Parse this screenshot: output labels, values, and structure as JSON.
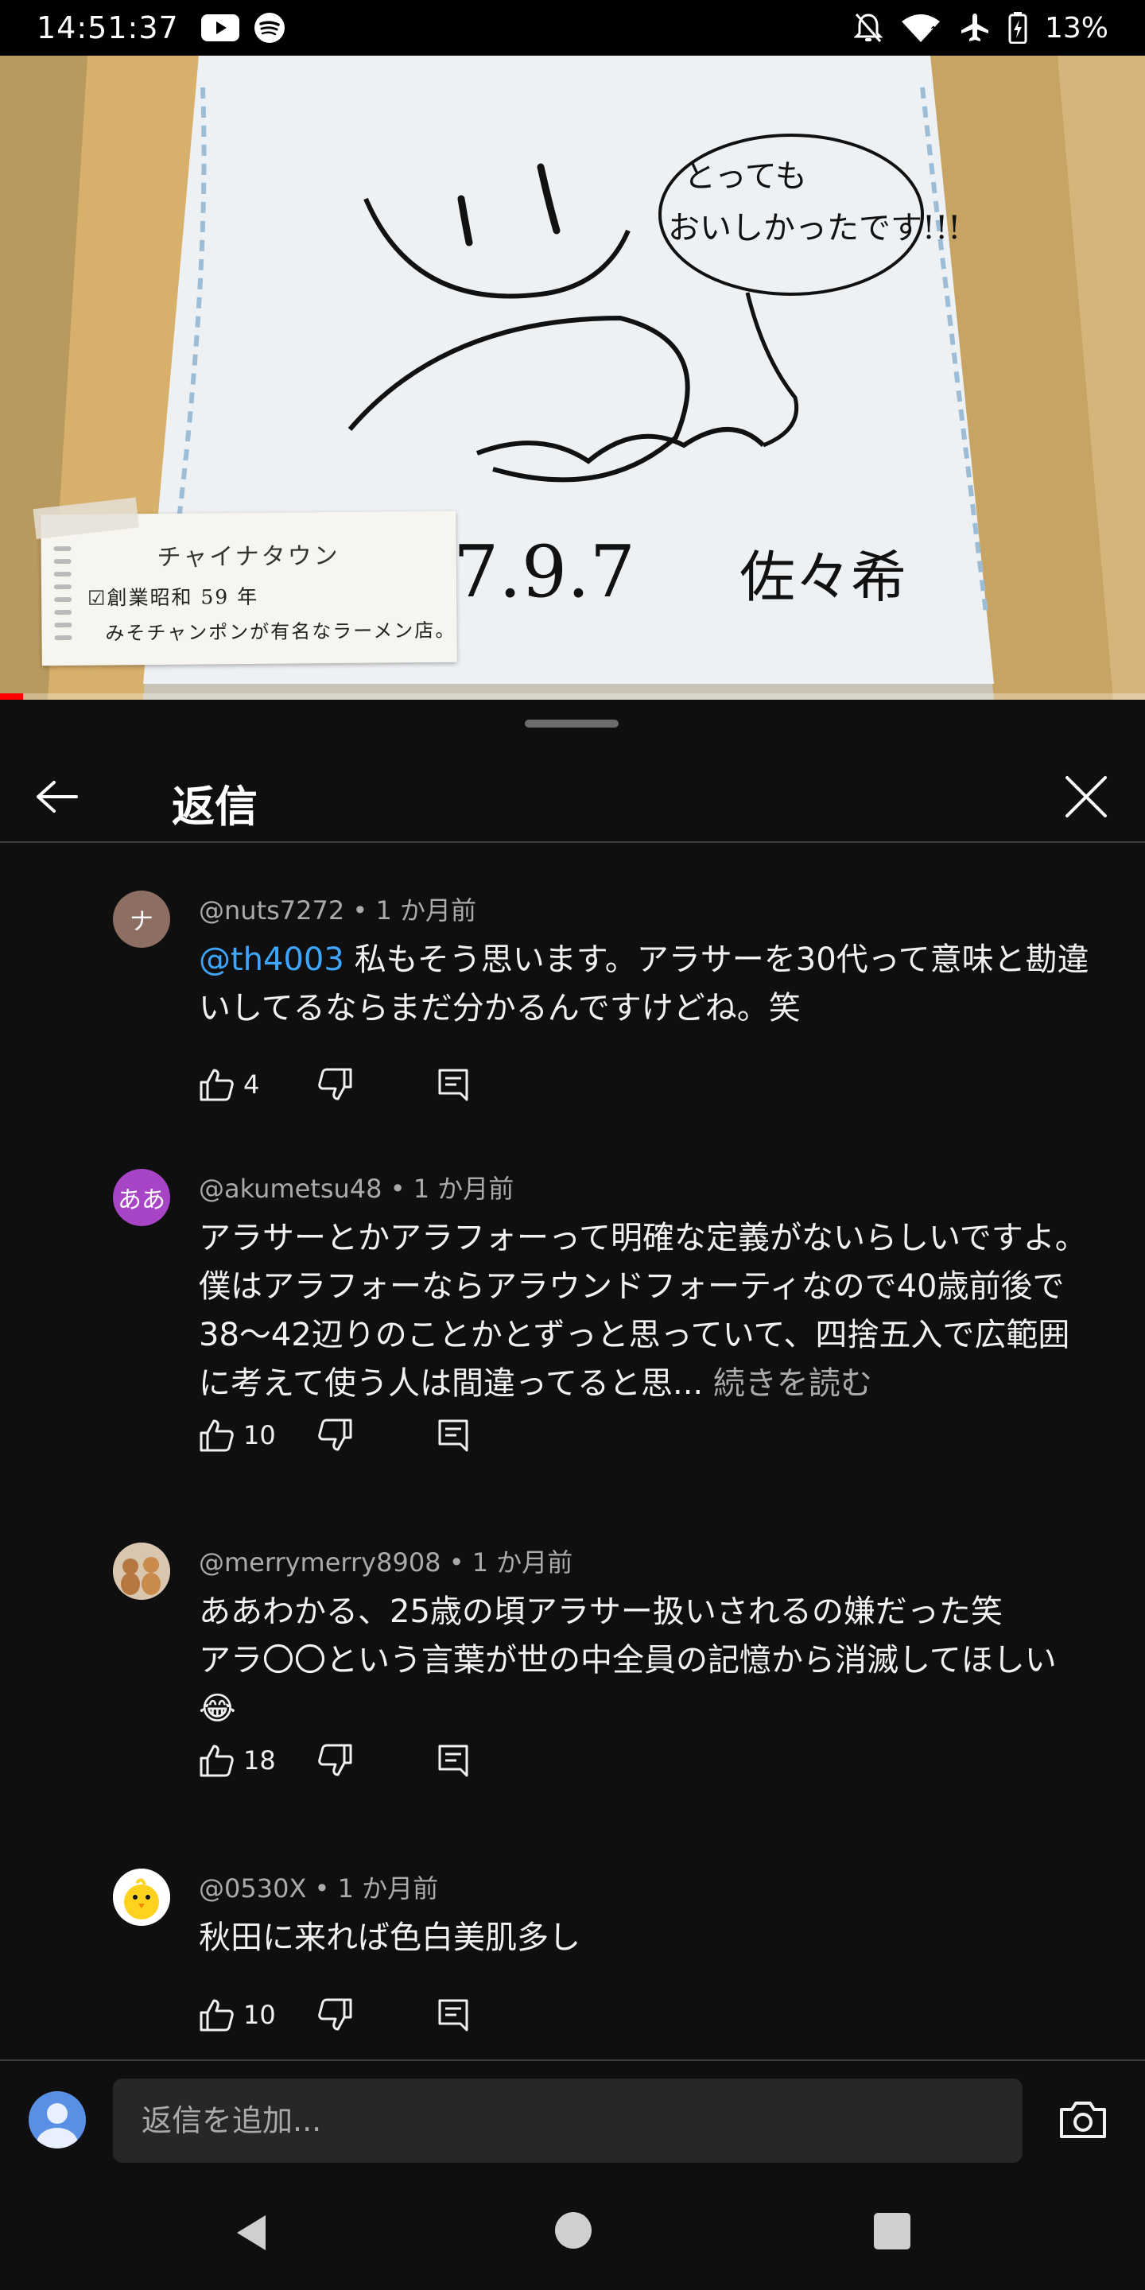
{
  "status_bar": {
    "time": "14:51:37",
    "battery": "13%",
    "icons": [
      "youtube-icon",
      "spotify-icon",
      "notifications-off-icon",
      "wifi-icon",
      "airplane-mode-icon",
      "battery-icon"
    ]
  },
  "video": {
    "overlay_title": "チャイナタウン",
    "overlay_line1": "☑創業昭和 59 年",
    "overlay_line2": "みそチャンポンが有名なラーメン店。",
    "progress": 0.02,
    "progress_color": "#ff0000"
  },
  "sheet": {
    "title": "返信"
  },
  "comments": [
    {
      "handle": "@nuts7272",
      "time": "1 か月前",
      "avatar_letter": "ナ",
      "avatar_color": "#8d6e63",
      "mention": "@th4003",
      "text": "私もそう思います。アラサーを30代って意味と勘違いしてるならまだ分かるんですけどね。笑",
      "likes": "4"
    },
    {
      "handle": "@akumetsu48",
      "time": "1 か月前",
      "avatar_letter": "ああ",
      "avatar_color": "#a845c6",
      "text": "アラサーとかアラフォーって明確な定義がないらしいですよ。僕はアラフォーならアラウンドフォーティなので40歳前後で38〜42辺りのことかとずっと思っていて、四捨五入で広範囲に考えて使う人は間違ってると思...",
      "read_more": "続きを読む",
      "likes": "10"
    },
    {
      "handle": "@merrymerry8908",
      "time": "1 か月前",
      "avatar_color": "#c9b49a",
      "text": "ああわかる、25歳の頃アラサー扱いされるの嫌だった笑\nアラ〇〇という言葉が世の中全員の記憶から消滅してほしい😂",
      "likes": "18"
    },
    {
      "handle": "@0530X",
      "time": "1 か月前",
      "avatar_color": "#ffffff",
      "text": "秋田に来れば色白美肌多し",
      "likes": "10"
    }
  ],
  "reply_bar": {
    "placeholder": "返信を追加..."
  }
}
